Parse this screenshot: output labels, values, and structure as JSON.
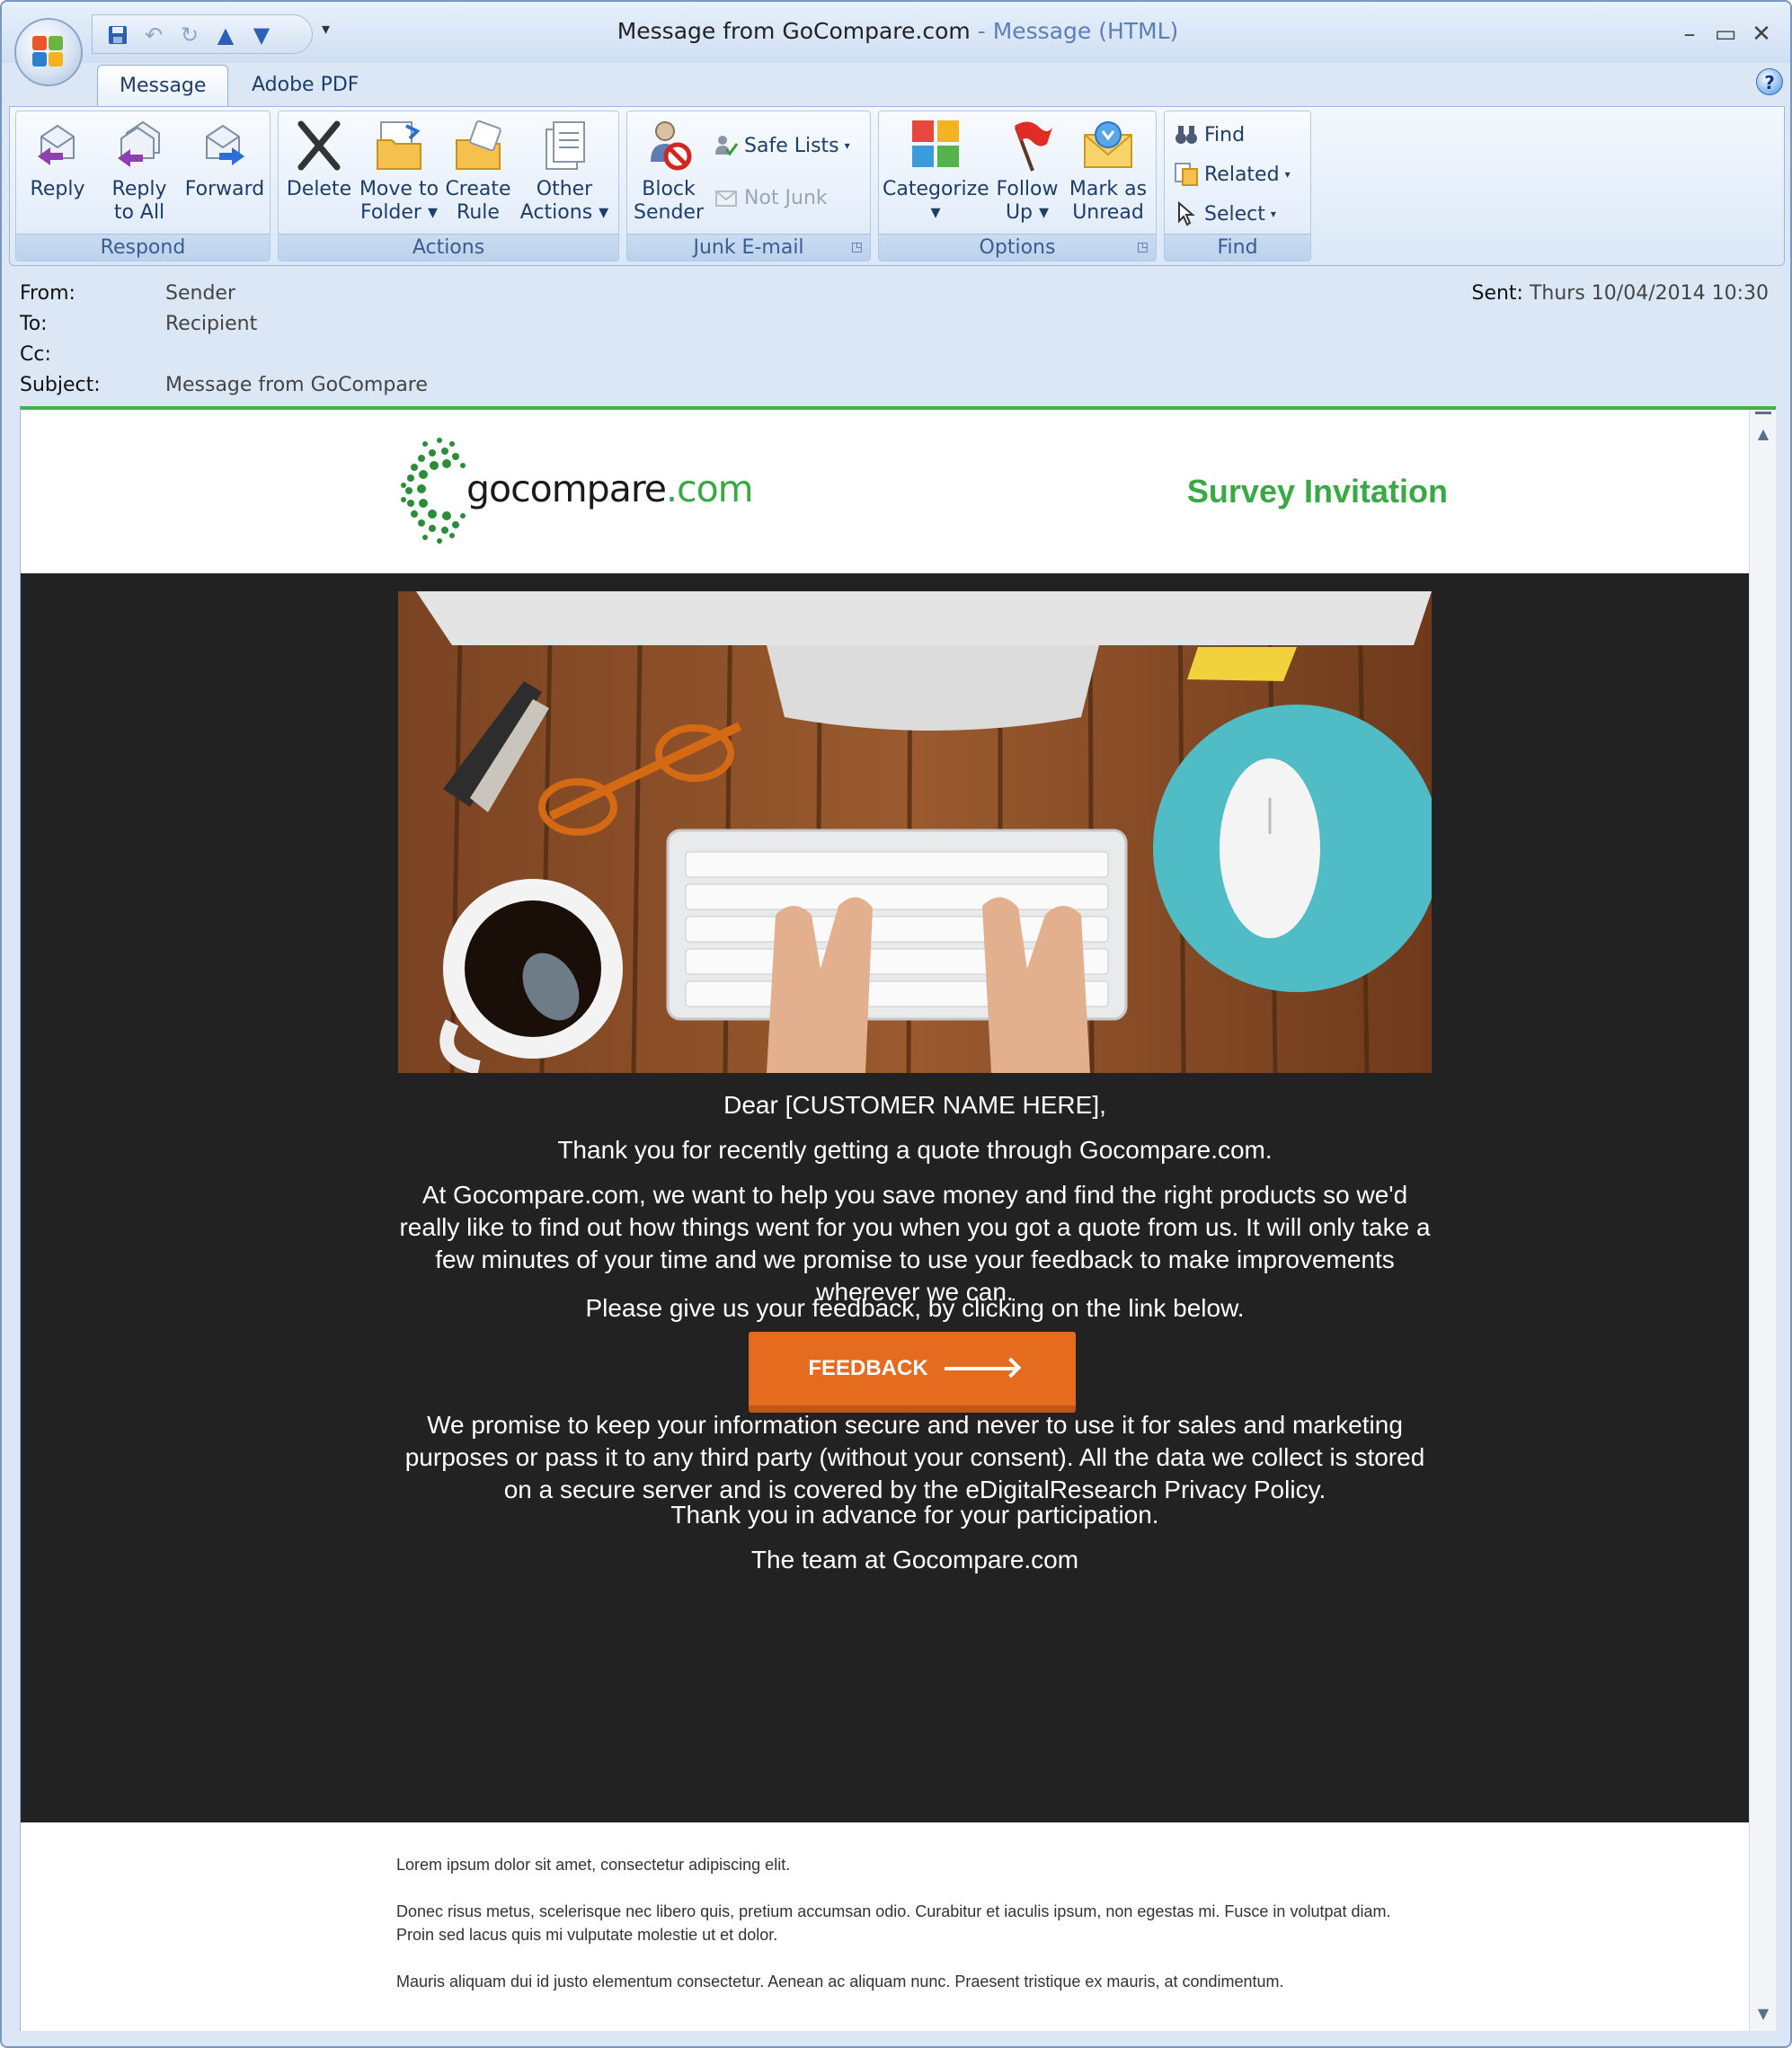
{
  "window": {
    "title": "Message from GoCompare.com",
    "title_separator": "-",
    "title_sub": "Message (HTML)",
    "controls": {
      "minimize": "–",
      "maximize": "▭",
      "close": "✕"
    }
  },
  "qat": {
    "dropdown": "▾"
  },
  "tabs": [
    {
      "label": "Message",
      "active": true
    },
    {
      "label": "Adobe PDF",
      "active": false
    }
  ],
  "help": "?",
  "ribbon": {
    "respond": {
      "label": "Respond",
      "buttons": [
        {
          "label1": "Reply",
          "label2": "",
          "icon": "reply-icon"
        },
        {
          "label1": "Reply",
          "label2": "to All",
          "icon": "reply-all-icon"
        },
        {
          "label1": "Forward",
          "label2": "",
          "icon": "forward-icon"
        }
      ]
    },
    "actions": {
      "label": "Actions",
      "buttons": [
        {
          "label1": "Delete",
          "label2": "",
          "icon": "delete-icon"
        },
        {
          "label1": "Move to",
          "label2": "Folder ▾",
          "icon": "move-folder-icon"
        },
        {
          "label1": "Create",
          "label2": "Rule",
          "icon": "create-rule-icon"
        },
        {
          "label1": "Other",
          "label2": "Actions ▾",
          "icon": "other-actions-icon"
        }
      ]
    },
    "junk": {
      "label": "Junk E-mail",
      "block_label1": "Block",
      "block_label2": "Sender",
      "safe_lists": "Safe Lists",
      "not_junk": "Not Junk"
    },
    "options": {
      "label": "Options",
      "buttons": [
        {
          "label1": "Categorize",
          "label2": "▾",
          "icon": "categorize-icon"
        },
        {
          "label1": "Follow",
          "label2": "Up ▾",
          "icon": "follow-up-flag-icon"
        },
        {
          "label1": "Mark as",
          "label2": "Unread",
          "icon": "mark-unread-icon"
        }
      ]
    },
    "find": {
      "label": "Find",
      "find": "Find",
      "related": "Related",
      "select": "Select"
    }
  },
  "headers": {
    "from_label": "From:",
    "from_value": "Sender",
    "to_label": "To:",
    "to_value": "Recipient",
    "cc_label": "Cc:",
    "cc_value": "",
    "subject_label": "Subject:",
    "subject_value": "Message from GoCompare",
    "sent_label": "Sent:",
    "sent_value": "Thurs 10/04/2014 10:30"
  },
  "email": {
    "logo_text_main": "gocompare",
    "logo_text_tld": ".com",
    "survey_title": "Survey Invitation",
    "greeting": "Dear [CUSTOMER NAME HERE],",
    "para1": "Thank you for recently getting a quote through Gocompare.com.",
    "para2": "At Gocompare.com, we want to help you save money and find the right products so we'd really like to find out how things went for you when you got a quote from us. It will only take a few minutes of your time and we promise to use your feedback to make improvements wherever we can.",
    "para3": "Please give us your feedback, by clicking on the link below.",
    "button": "FEEDBACK",
    "para4": "We promise to keep your information secure and never to use it for sales and marketing purposes or pass it to any third party (without your consent). All the data we collect is stored on a secure server and is covered by the eDigitalResearch Privacy Policy.",
    "para5": "Thank you in advance for your participation.",
    "signoff": "The team at Gocompare.com",
    "footer1": "Lorem ipsum dolor sit amet, consectetur adipiscing elit.",
    "footer2": "Donec risus metus, scelerisque nec libero quis, pretium accumsan odio. Curabitur et iaculis ipsum, non egestas mi. Fusce in volutpat diam. Proin sed lacus quis mi vulputate molestie ut et dolor.",
    "footer3": "Mauris aliquam dui id justo elementum consectetur. Aenean ac aliquam nunc. Praesent tristique ex mauris, at condimentum."
  },
  "colors": {
    "brand_green": "#39a845",
    "button_orange": "#e56b1f",
    "dark_panel": "#222222"
  }
}
